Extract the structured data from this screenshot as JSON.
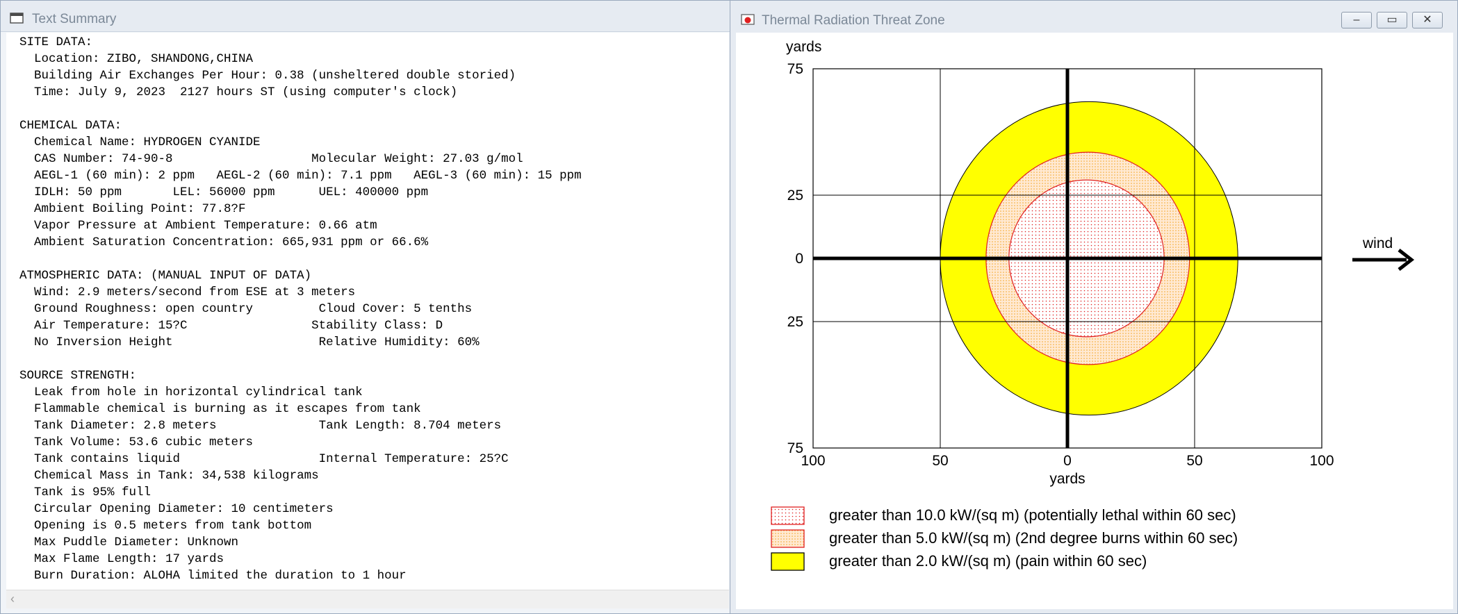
{
  "summary_window": {
    "title": "Text Summary",
    "lines": [
      "SITE DATA:",
      "  Location: ZIBO, SHANDONG,CHINA",
      "  Building Air Exchanges Per Hour: 0.38 (unsheltered double storied)",
      "  Time: July 9, 2023  2127 hours ST (using computer's clock)",
      "",
      "CHEMICAL DATA:",
      "  Chemical Name: HYDROGEN CYANIDE",
      "  CAS Number: 74-90-8                   Molecular Weight: 27.03 g/mol",
      "  AEGL-1 (60 min): 2 ppm   AEGL-2 (60 min): 7.1 ppm   AEGL-3 (60 min): 15 ppm",
      "  IDLH: 50 ppm       LEL: 56000 ppm      UEL: 400000 ppm",
      "  Ambient Boiling Point: 77.8?F",
      "  Vapor Pressure at Ambient Temperature: 0.66 atm",
      "  Ambient Saturation Concentration: 665,931 ppm or 66.6%",
      "",
      "ATMOSPHERIC DATA: (MANUAL INPUT OF DATA)",
      "  Wind: 2.9 meters/second from ESE at 3 meters",
      "  Ground Roughness: open country         Cloud Cover: 5 tenths",
      "  Air Temperature: 15?C                 Stability Class: D",
      "  No Inversion Height                    Relative Humidity: 60%",
      "",
      "SOURCE STRENGTH:",
      "  Leak from hole in horizontal cylindrical tank",
      "  Flammable chemical is burning as it escapes from tank",
      "  Tank Diameter: 2.8 meters              Tank Length: 8.704 meters",
      "  Tank Volume: 53.6 cubic meters",
      "  Tank contains liquid                   Internal Temperature: 25?C",
      "  Chemical Mass in Tank: 34,538 kilograms",
      "  Tank is 95% full",
      "  Circular Opening Diameter: 10 centimeters",
      "  Opening is 0.5 meters from tank bottom",
      "  Max Puddle Diameter: Unknown",
      "  Max Flame Length: 17 yards",
      "  Burn Duration: ALOHA limited the duration to 1 hour"
    ],
    "scroll_left_glyph": "‹"
  },
  "zone_window": {
    "title": "Thermal Radiation Threat Zone",
    "buttons": {
      "minimize": "–",
      "maximize": "▭",
      "close": "✕"
    },
    "wind_label": "wind"
  },
  "chart_data": {
    "type": "area",
    "x": {
      "label": "yards",
      "ticks": [
        "100",
        "50",
        "0",
        "50",
        "100"
      ],
      "tick_values": [
        -100,
        -50,
        0,
        50,
        100
      ],
      "range": [
        -100,
        100
      ]
    },
    "y": {
      "label": "yards",
      "ticks": [
        "75",
        "25",
        "0",
        "25",
        "75"
      ],
      "tick_values": [
        75,
        25,
        0,
        -25,
        -75
      ],
      "range": [
        -75,
        75
      ]
    },
    "grid": true,
    "zones": [
      {
        "label": "greater than 2.0 kW/(sq m) (pain within 60 sec)",
        "color": "#ffff00",
        "pattern": "solid",
        "x_range": [
          -50,
          67
        ],
        "y_range": [
          -62,
          62
        ]
      },
      {
        "label": "greater than 5.0 kW/(sq m) (2nd degree burns within 60 sec)",
        "color": "#f5a623",
        "pattern": "dots",
        "x_range": [
          -32,
          48
        ],
        "y_range": [
          -42,
          42
        ]
      },
      {
        "label": "greater than 10.0 kW/(sq m) (potentially lethal within 60 sec)",
        "color": "#e02020",
        "pattern": "dots",
        "x_range": [
          -23,
          38
        ],
        "y_range": [
          -31,
          31
        ]
      }
    ],
    "legend_order": [
      2,
      1,
      0
    ]
  }
}
